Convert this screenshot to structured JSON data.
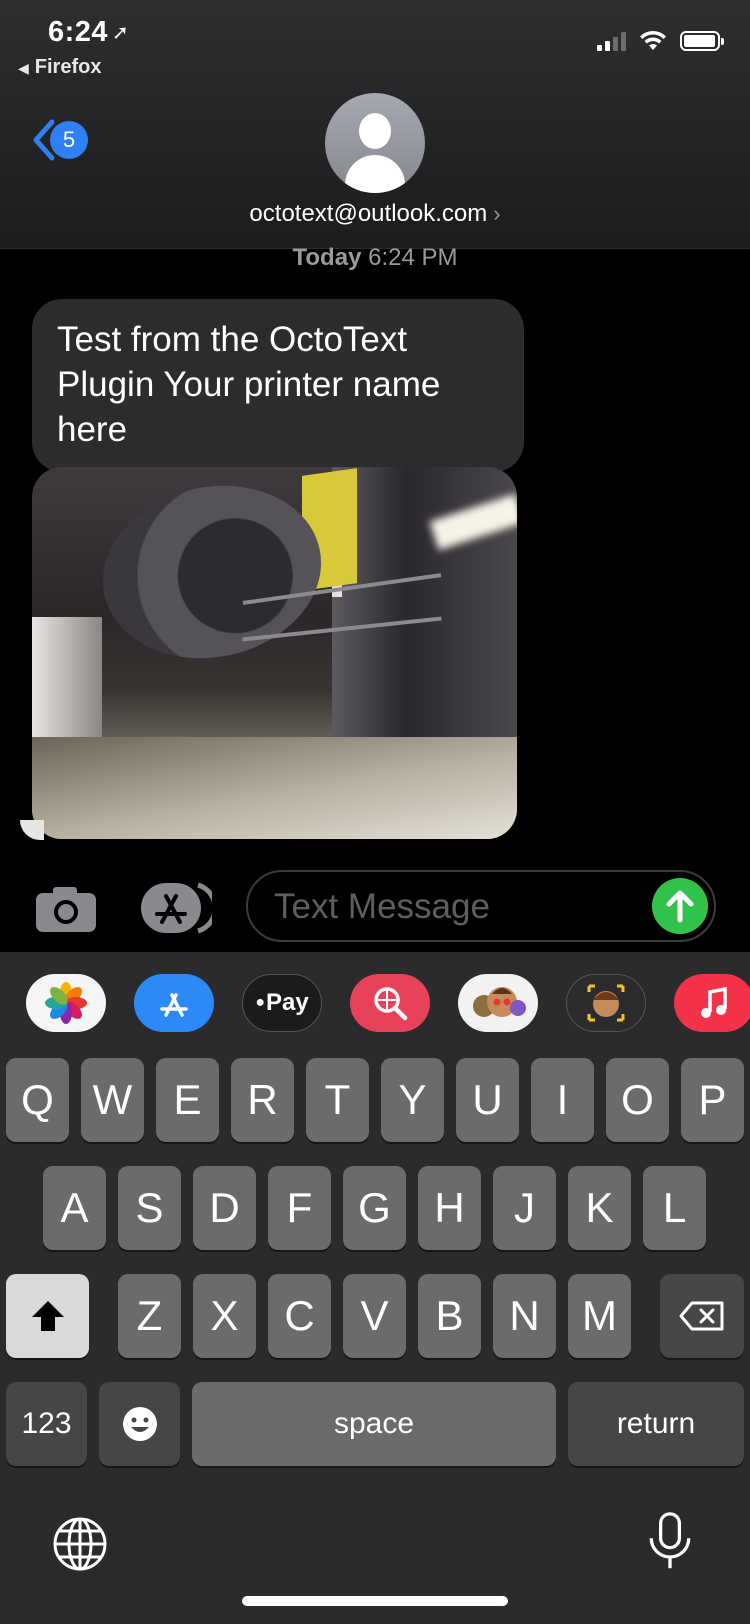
{
  "status_bar": {
    "time": "6:24",
    "back_app": "Firefox"
  },
  "header": {
    "unread_count": "5",
    "contact": "octotext@outlook.com"
  },
  "conversation": {
    "timestamp_day": "Today",
    "timestamp_time": "6:24 PM",
    "message_text": "Test from the OctoText Plugin Your printer name here"
  },
  "composer": {
    "placeholder": "Text Message",
    "value": ""
  },
  "app_drawer": [
    "photos-app-icon",
    "app-store-icon",
    "apple-pay-icon",
    "search-images-icon",
    "memoji-stickers-icon",
    "animoji-icon",
    "music-app-icon"
  ],
  "apple_pay_label": "Pay",
  "keyboard": {
    "row1": [
      "Q",
      "W",
      "E",
      "R",
      "T",
      "Y",
      "U",
      "I",
      "O",
      "P"
    ],
    "row2": [
      "A",
      "S",
      "D",
      "F",
      "G",
      "H",
      "J",
      "K",
      "L"
    ],
    "row3": [
      "Z",
      "X",
      "C",
      "V",
      "B",
      "N",
      "M"
    ],
    "numbers_key": "123",
    "space_key": "space",
    "return_key": "return"
  },
  "colors": {
    "accent_blue": "#2f7ff5",
    "send_green": "#30c24a",
    "bubble_gray": "#2c2c2e",
    "key_gray": "#6b6b6d"
  }
}
